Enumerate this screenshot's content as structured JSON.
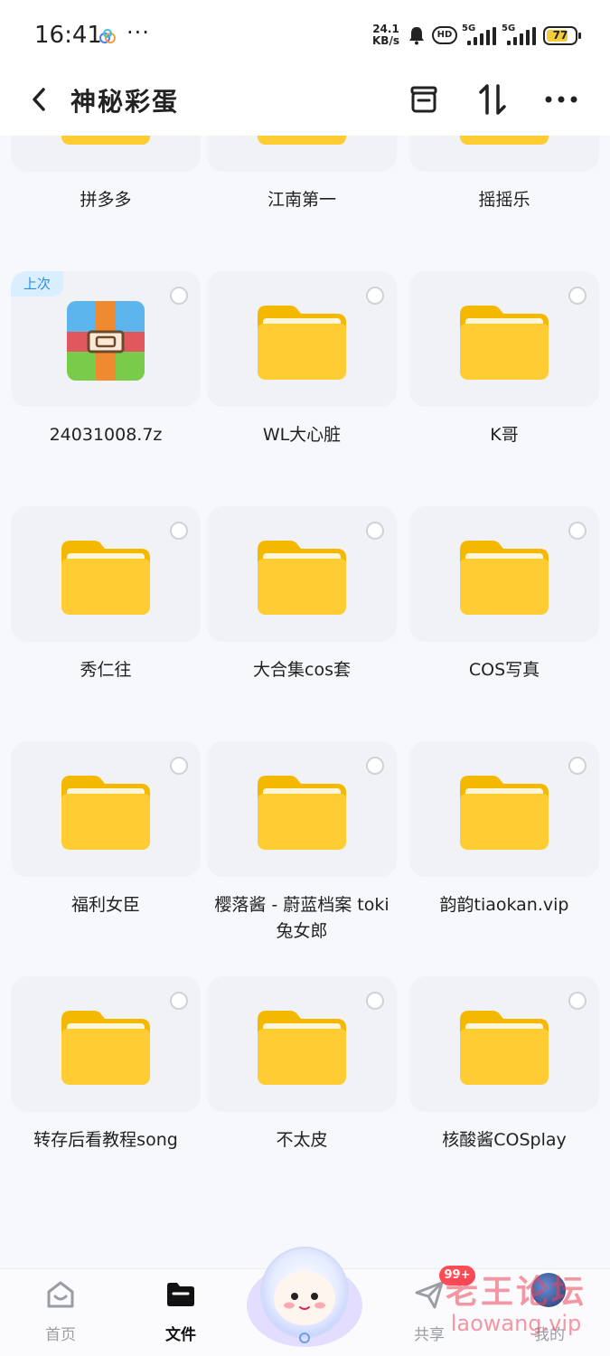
{
  "status_bar": {
    "time": "16:41",
    "more": "···",
    "net_speed_value": "24.1",
    "net_speed_unit": "KB/s",
    "hd_label": "HD",
    "sim1_label": "5G",
    "sim2_label": "5G",
    "battery_percent": "77",
    "battery_level": 0.77,
    "icons": [
      "cloud-app-icon",
      "bell-icon",
      "hd-icon",
      "signal-icon",
      "battery-icon"
    ]
  },
  "header": {
    "title": "神秘彩蛋",
    "icons": [
      "back-icon",
      "archive-box-icon",
      "sort-icon",
      "more-icon"
    ]
  },
  "files": [
    {
      "name": "拼多多",
      "type": "folder"
    },
    {
      "name": "江南第一",
      "type": "folder"
    },
    {
      "name": "摇摇乐",
      "type": "folder"
    },
    {
      "name": "24031008.7z",
      "type": "archive",
      "tag": "上次"
    },
    {
      "name": "WL大心脏",
      "type": "folder"
    },
    {
      "name": "K哥",
      "type": "folder"
    },
    {
      "name": "秀仁往",
      "type": "folder"
    },
    {
      "name": "大合集cos套",
      "type": "folder"
    },
    {
      "name": "COS写真",
      "type": "folder"
    },
    {
      "name": "福利女臣",
      "type": "folder"
    },
    {
      "name": "樱落酱 - 蔚蓝档案 toki兔女郎",
      "type": "folder"
    },
    {
      "name": "韵韵tiaokan.vip",
      "type": "folder"
    },
    {
      "name": "转存后看教程song",
      "type": "folder"
    },
    {
      "name": "不太皮",
      "type": "folder"
    },
    {
      "name": "核酸酱COSplay",
      "type": "folder"
    }
  ],
  "bottom_nav": {
    "home": "首页",
    "files": "文件",
    "share": "共享",
    "mine": "我的",
    "share_badge": "99+",
    "active": "files"
  },
  "watermark": {
    "line1": "老王论坛",
    "line2": "laowang.vip"
  },
  "colors": {
    "folder": "#ffcc33",
    "folder_dark": "#f5b800",
    "accent_blue": "#2e8ce6",
    "badge_red": "#ff4b55"
  }
}
